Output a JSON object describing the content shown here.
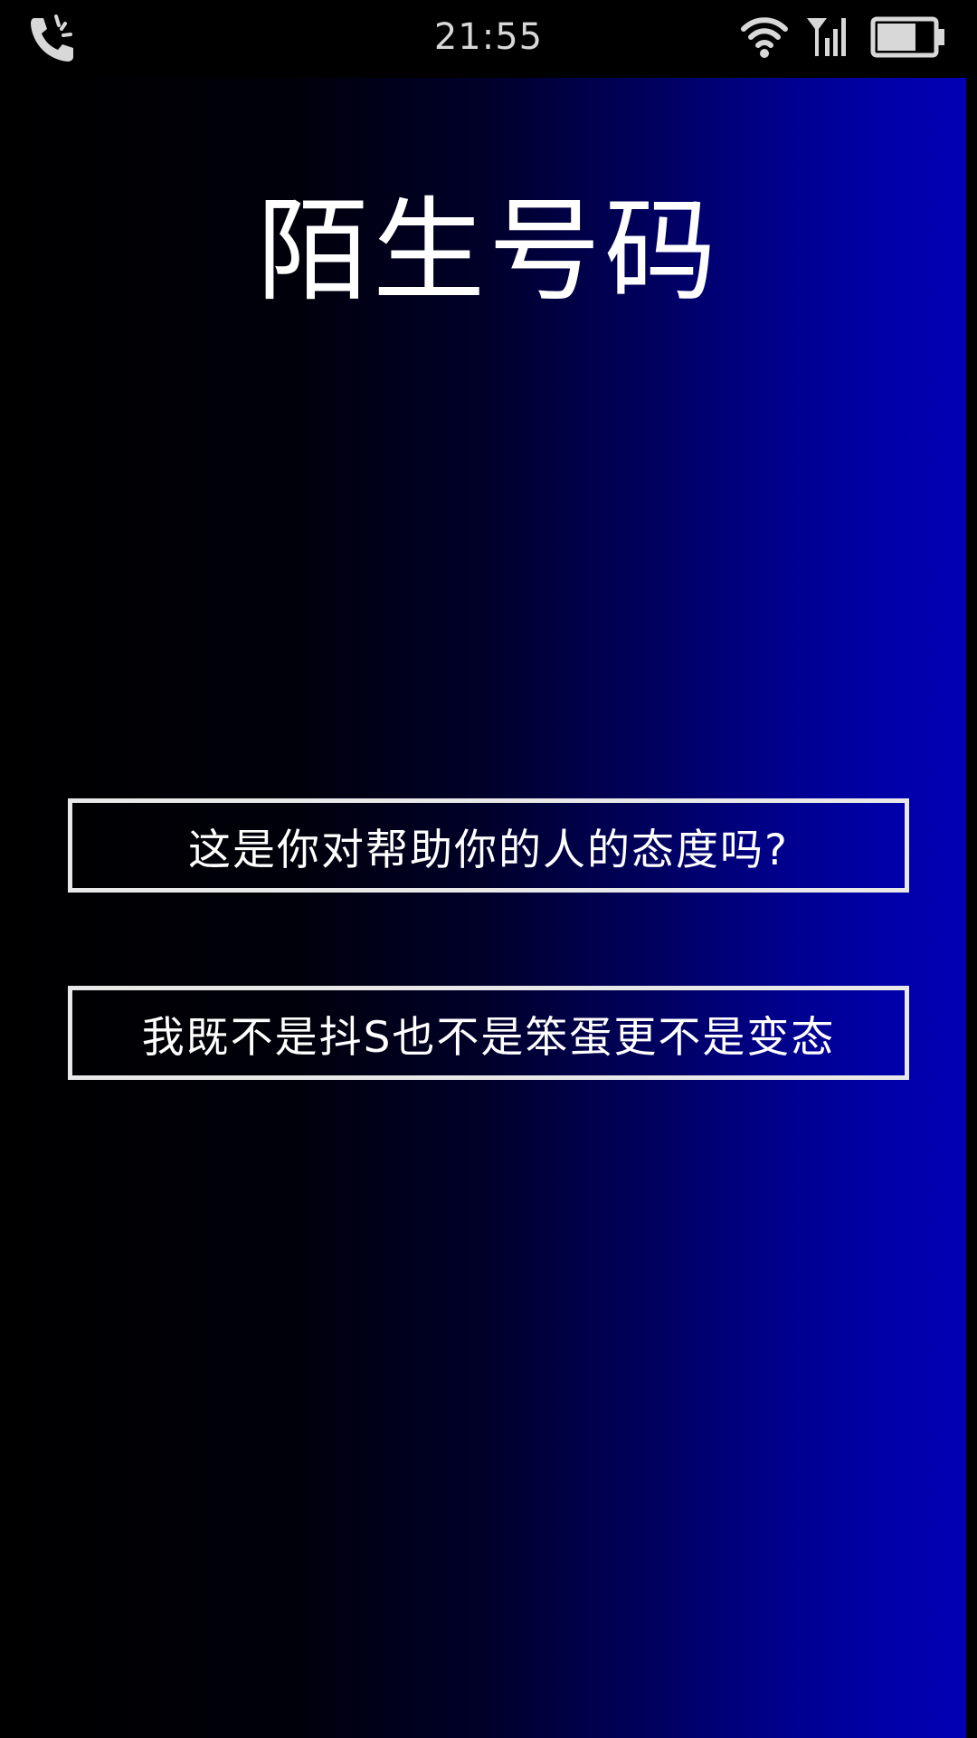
{
  "status_bar": {
    "time": "21:55",
    "icons": {
      "left": "phone-call-icon",
      "wifi": "wifi-icon",
      "signal": "cell-signal-icon",
      "battery": "battery-icon"
    }
  },
  "page": {
    "title": "陌生号码"
  },
  "options": [
    {
      "label": "这是你对帮助你的人的态度吗?"
    },
    {
      "label": "我既不是抖S也不是笨蛋更不是变态"
    }
  ],
  "colors": {
    "background_left": "#000000",
    "background_right": "#0000b4",
    "text": "#ffffff",
    "button_border": "#e8e8e8"
  }
}
